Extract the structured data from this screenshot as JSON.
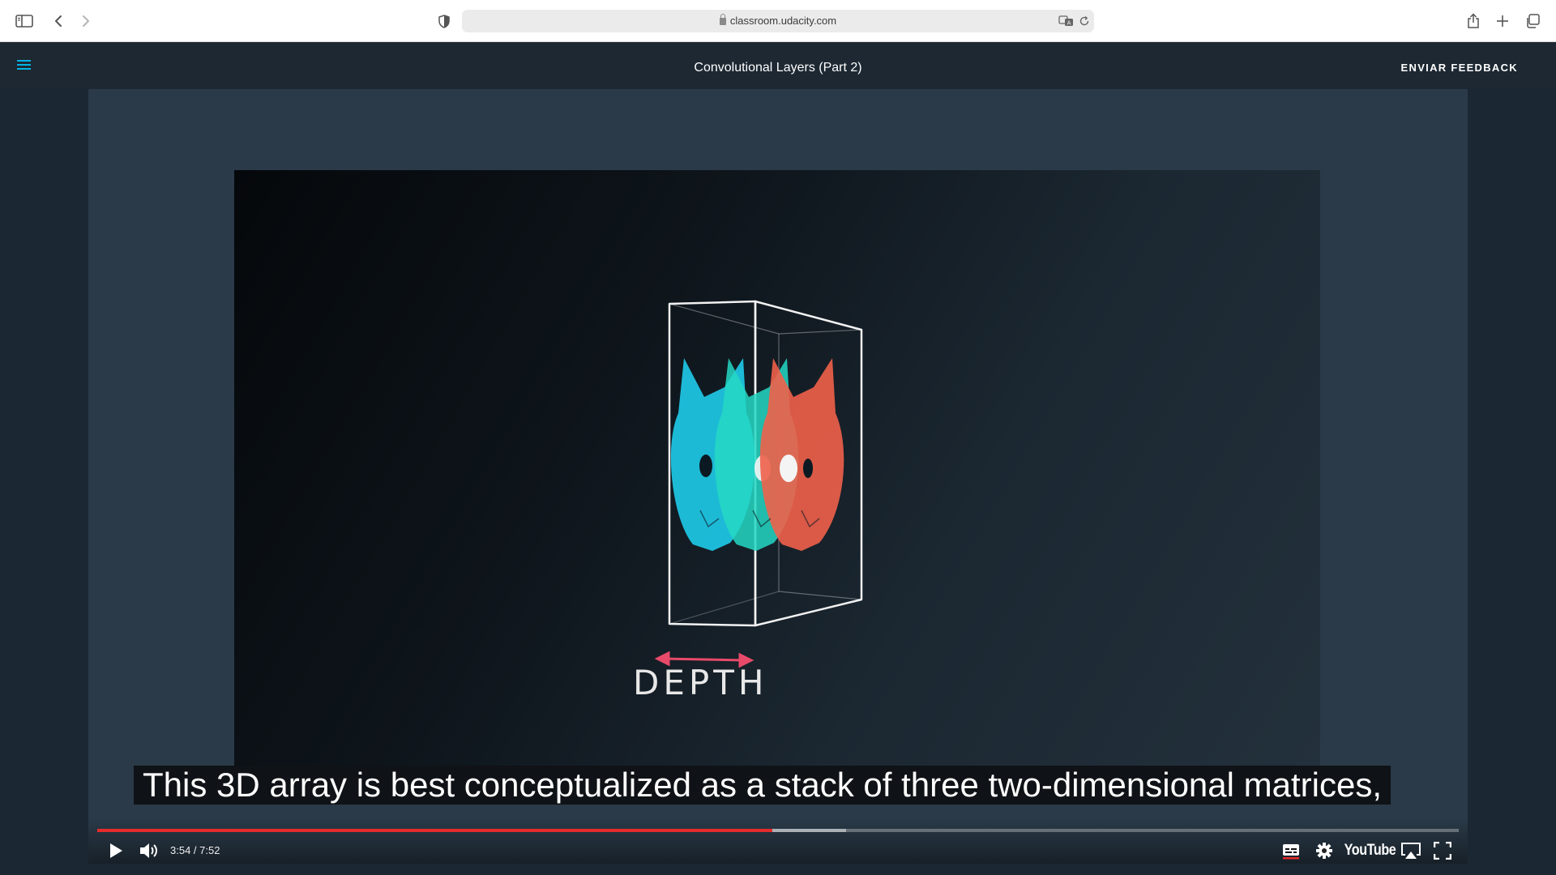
{
  "browser": {
    "url": "classroom.udacity.com",
    "icons": [
      "sidebar-icon",
      "back-icon",
      "forward-icon",
      "shield-icon",
      "translate-icon",
      "reload-icon",
      "share-icon",
      "new-tab-icon",
      "tab-overview-icon"
    ]
  },
  "header": {
    "title": "Convolutional Layers (Part 2)",
    "feedback_label": "ENVIAR FEEDBACK",
    "accent_color": "#02b3e4"
  },
  "video": {
    "slide_label": "DEPTH",
    "caption": "This 3D array is best conceptualized as a stack of three two-dimensional matrices,",
    "time_display": "3:54 / 7:52",
    "progress_fraction": 0.496,
    "buffered_fraction": 0.55,
    "youtube_label": "YouTube",
    "colors": {
      "played": "#e52b2b",
      "cyan_layer": "#1ec8e6",
      "teal_layer": "#24d8c4",
      "red_layer": "#f0604a",
      "arrow": "#e84a6a"
    }
  }
}
